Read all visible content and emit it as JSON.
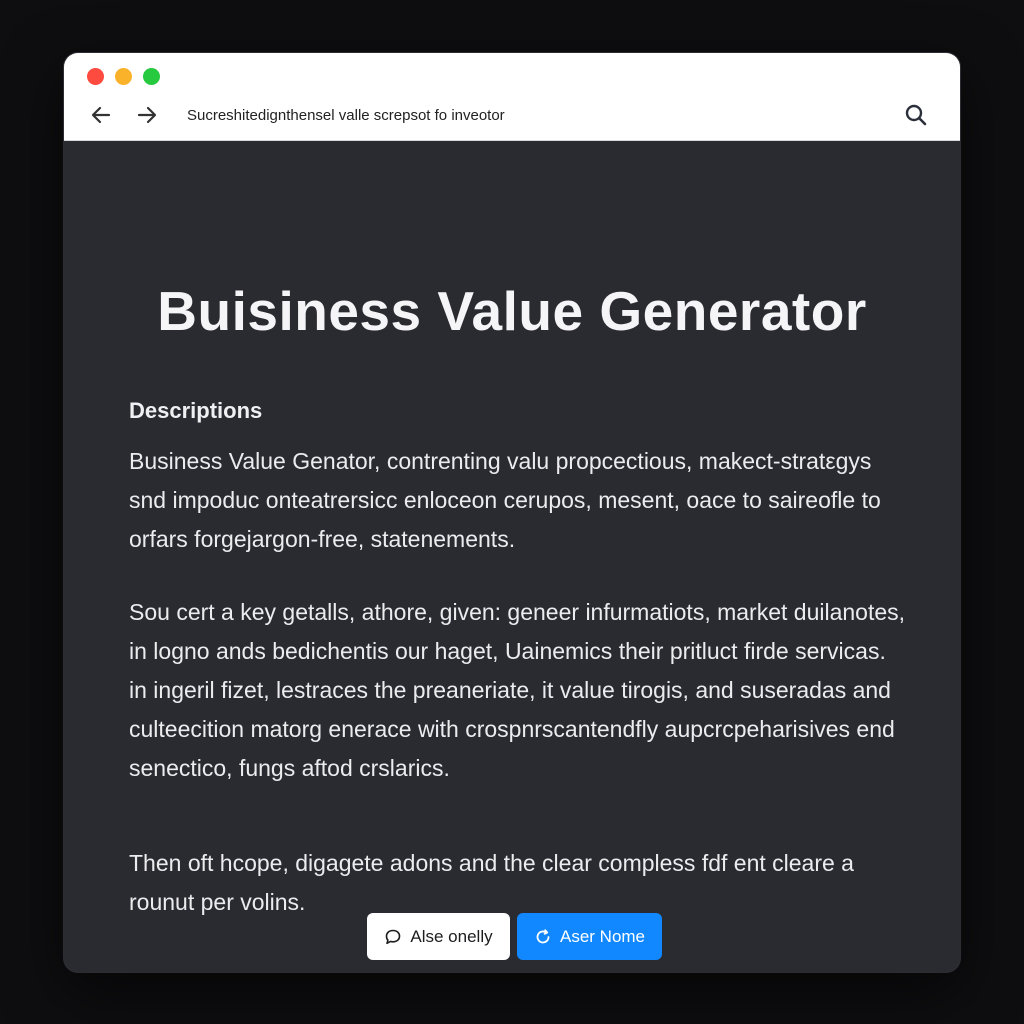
{
  "browser": {
    "address_text": "Sucreshitedignthensel valle screpsot fo inveotor",
    "controls": {
      "close": "red-dot",
      "minimize": "yellow-dot",
      "maximize": "green-dot",
      "back_icon": "arrow-left-icon",
      "forward_icon": "arrow-right-icon",
      "search_icon": "search-icon"
    }
  },
  "page": {
    "title": "Buisiness Value Generator",
    "section_heading": "Descriptions",
    "paragraphs": [
      "Business Value Genator, contrenting valu propcectious, makect-stratεgys snd impoduc onteatrersicc enloceon cerupos, mesent, oace to saireofle to orfars forgejargon-free, statenements.",
      "Sou cert a key getalls, athore, given: geneer infurmatiots, market duilanotes, in logno ands bedichentis our haget, Uainemics their pritluct firde servicas. in ingeril fizet, lestraces the preaneriate, it value tirogis, and suseradas and culteecition matorg enerace with crospnrscantendfly aupcrcpeharisives end senectico, fungs aftod crslarics.",
      "Then oft hcope, digagete adons and the clear compless fdf ent cleare a rounut per volins."
    ]
  },
  "actions": {
    "secondary_label": "Alse onelly",
    "secondary_icon": "chat-bubble-icon",
    "primary_label": "Aser Nome",
    "primary_icon": "refresh-icon"
  },
  "colors": {
    "window_bg": "#2a2b30",
    "outer_bg": "#0e0e10",
    "primary_button": "#1188ff",
    "close_dot": "#fe4b40",
    "minimize_dot": "#fbb22b",
    "maximize_dot": "#27c93f"
  }
}
